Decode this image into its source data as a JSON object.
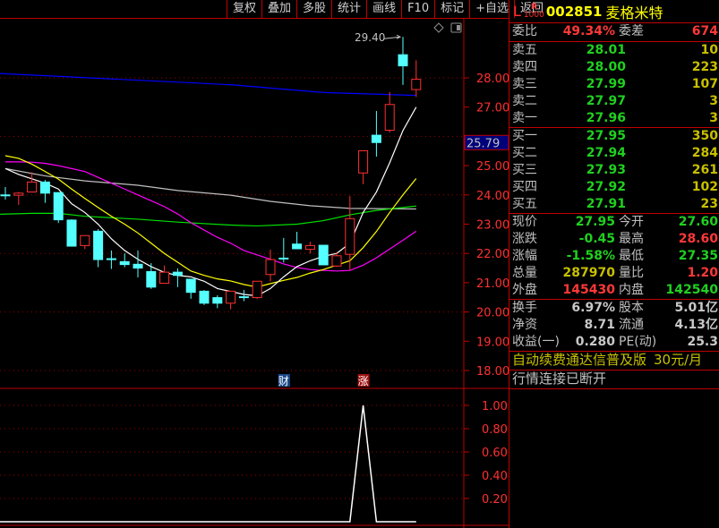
{
  "toolbar": {
    "buttons": [
      "复权",
      "叠加",
      "多股",
      "统计",
      "画线",
      "F10",
      "标记",
      "+自选",
      "返回"
    ]
  },
  "stock": {
    "prefix": "L",
    "badge_top": "R",
    "badge_bottom": "1000",
    "code": "002851",
    "name": "麦格米特"
  },
  "weibi": {
    "label": "委比",
    "value": "49.34%",
    "label2": "委差",
    "value2": "674"
  },
  "sell": [
    {
      "label": "卖五",
      "price": "28.01",
      "vol": "10"
    },
    {
      "label": "卖四",
      "price": "28.00",
      "vol": "223"
    },
    {
      "label": "卖三",
      "price": "27.99",
      "vol": "107"
    },
    {
      "label": "卖二",
      "price": "27.97",
      "vol": "3"
    },
    {
      "label": "卖一",
      "price": "27.96",
      "vol": "3"
    }
  ],
  "buy": [
    {
      "label": "买一",
      "price": "27.95",
      "vol": "350"
    },
    {
      "label": "买二",
      "price": "27.94",
      "vol": "284"
    },
    {
      "label": "买三",
      "price": "27.93",
      "vol": "261"
    },
    {
      "label": "买四",
      "price": "27.92",
      "vol": "102"
    },
    {
      "label": "买五",
      "price": "27.91",
      "vol": "23"
    }
  ],
  "quote": [
    {
      "l1": "现价",
      "v1": "27.95",
      "c1": "g",
      "l2": "今开",
      "v2": "27.60",
      "c2": "g"
    },
    {
      "l1": "涨跌",
      "v1": "-0.45",
      "c1": "g",
      "l2": "最高",
      "v2": "28.60",
      "c2": "r"
    },
    {
      "l1": "涨幅",
      "v1": "-1.58%",
      "c1": "g",
      "l2": "最低",
      "v2": "27.35",
      "c2": "g"
    },
    {
      "l1": "总量",
      "v1": "287970",
      "c1": "y",
      "l2": "量比",
      "v2": "1.20",
      "c2": "r"
    },
    {
      "l1": "外盘",
      "v1": "145430",
      "c1": "r",
      "l2": "内盘",
      "v2": "142540",
      "c2": "g"
    }
  ],
  "finance": [
    {
      "l1": "换手",
      "v1": "6.97%",
      "l2": "股本",
      "v2": "5.01亿"
    },
    {
      "l1": "净资",
      "v1": "8.71",
      "l2": "流通",
      "v2": "4.13亿"
    },
    {
      "l1": "收益(一)",
      "v1": "0.280",
      "l2": "PE(动)",
      "v2": "25.3"
    }
  ],
  "promo": {
    "text": "自动续费通达信普及版",
    "price": "30元/月"
  },
  "status": "行情连接已断开",
  "chart_data": [
    {
      "type": "candlestick",
      "price_axis": {
        "ticks": [
          "28.00",
          "27.00",
          "25.00",
          "24.00",
          "23.00",
          "22.00",
          "21.00",
          "20.00",
          "19.00",
          "18.00"
        ],
        "range": [
          17.9,
          29.8
        ],
        "grid": [
          28,
          26,
          24,
          22,
          20,
          18
        ]
      },
      "current_price_label": "25.79",
      "high_annotation": "29.40",
      "colors": {
        "up": "#ff3030",
        "down": "#54ffff",
        "ma5": "#ffffff",
        "ma10": "#ffff00",
        "ma20": "#ff00ff",
        "ma60": "#c0c0c0",
        "ma_green": "#00e000",
        "ma_blue": "#0000ff"
      },
      "candles": [
        [
          24.0,
          24.27,
          23.84,
          24.0
        ],
        [
          23.99,
          24.1,
          23.66,
          24.06
        ],
        [
          24.1,
          24.77,
          24.1,
          24.44
        ],
        [
          24.44,
          24.51,
          23.73,
          24.06
        ],
        [
          24.08,
          24.08,
          23.04,
          23.15
        ],
        [
          23.14,
          23.17,
          22.23,
          22.25
        ],
        [
          22.27,
          22.61,
          22.15,
          22.61
        ],
        [
          22.76,
          22.83,
          21.53,
          21.79
        ],
        [
          21.82,
          22.1,
          21.47,
          21.79
        ],
        [
          21.72,
          22.0,
          21.53,
          21.62
        ],
        [
          21.63,
          22.1,
          21.18,
          21.5
        ],
        [
          21.38,
          21.67,
          20.79,
          20.85
        ],
        [
          20.98,
          21.59,
          20.98,
          21.36
        ],
        [
          21.36,
          21.49,
          20.85,
          21.25
        ],
        [
          21.12,
          21.12,
          20.45,
          20.67
        ],
        [
          20.71,
          20.75,
          20.24,
          20.3
        ],
        [
          20.49,
          20.57,
          20.13,
          20.3
        ],
        [
          20.3,
          20.71,
          20.09,
          20.71
        ],
        [
          20.52,
          20.75,
          20.37,
          20.52
        ],
        [
          20.49,
          21.05,
          20.45,
          21.05
        ],
        [
          21.28,
          22.13,
          21.04,
          21.79
        ],
        [
          21.84,
          22.53,
          21.69,
          21.84
        ],
        [
          22.32,
          22.74,
          22.16,
          22.16
        ],
        [
          22.14,
          22.4,
          22.0,
          22.27
        ],
        [
          22.28,
          22.28,
          21.61,
          21.61
        ],
        [
          21.57,
          22.05,
          21.54,
          21.92
        ],
        [
          21.97,
          23.96,
          21.43,
          23.19
        ],
        [
          24.75,
          25.51,
          24.37,
          25.51
        ],
        [
          26.04,
          26.87,
          25.31,
          25.79
        ],
        [
          26.21,
          27.52,
          26.13,
          27.09
        ],
        [
          28.79,
          29.4,
          27.76,
          28.41
        ],
        [
          27.6,
          28.6,
          27.35,
          27.95
        ]
      ],
      "ma_lines": {
        "ma5": [
          24.9,
          24.7,
          24.55,
          24.4,
          24.2,
          23.7,
          23.4,
          23.0,
          22.5,
          22.1,
          21.8,
          21.55,
          21.35,
          21.25,
          21.2,
          21.05,
          20.8,
          20.7,
          20.6,
          20.55,
          20.8,
          21.2,
          21.55,
          21.75,
          21.9,
          22.0,
          22.35,
          23.4,
          24.1,
          25.1,
          26.2,
          27.0
        ],
        "ma10": [
          25.34,
          25.25,
          25.05,
          24.8,
          24.54,
          24.2,
          23.88,
          23.57,
          23.27,
          23.0,
          22.7,
          22.35,
          22.0,
          21.7,
          21.4,
          21.25,
          21.13,
          21.06,
          20.94,
          20.85,
          20.97,
          21.08,
          21.18,
          21.33,
          21.45,
          21.6,
          21.75,
          22.2,
          22.75,
          23.4,
          24.0,
          24.56
        ],
        "ma20": [
          25.13,
          25.13,
          25.12,
          25.08,
          25.0,
          24.9,
          24.8,
          24.6,
          24.4,
          24.2,
          24.0,
          23.8,
          23.6,
          23.35,
          23.05,
          22.8,
          22.55,
          22.35,
          22.1,
          21.95,
          21.8,
          21.64,
          21.52,
          21.45,
          21.42,
          21.4,
          21.42,
          21.6,
          21.85,
          22.15,
          22.45,
          22.76
        ],
        "ma60": [
          [
            0,
            24.9
          ],
          [
            3,
            24.65
          ],
          [
            6,
            24.48
          ],
          [
            10,
            24.33
          ],
          [
            13,
            24.15
          ],
          [
            17,
            23.99
          ],
          [
            20,
            23.78
          ],
          [
            23,
            23.63
          ],
          [
            26,
            23.54
          ],
          [
            31,
            23.52
          ]
        ],
        "ma_green": [
          [
            -0.4,
            23.34
          ],
          [
            2,
            23.37
          ],
          [
            4,
            23.37
          ],
          [
            6,
            23.27
          ],
          [
            10,
            23.17
          ],
          [
            13,
            23.07
          ],
          [
            17,
            22.97
          ],
          [
            19,
            22.94
          ],
          [
            22,
            23.0
          ],
          [
            24,
            23.12
          ],
          [
            26,
            23.32
          ],
          [
            28,
            23.47
          ],
          [
            31,
            23.62
          ]
        ],
        "ma_blue": [
          [
            -0.4,
            28.15
          ],
          [
            17.2,
            27.76
          ],
          [
            24,
            27.5
          ],
          [
            31,
            27.4
          ]
        ]
      },
      "markers": [
        {
          "index": 21,
          "text": "财",
          "color": "#1a4a8a"
        },
        {
          "index": 27,
          "text": "涨",
          "color": "#a01010"
        }
      ]
    },
    {
      "type": "line",
      "y_ticks": [
        "1.00",
        "0.80",
        "0.60",
        "0.40",
        "0.20"
      ],
      "ylim": [
        0,
        1.1
      ],
      "values": [
        0,
        0,
        0,
        0,
        0,
        0,
        0,
        0,
        0,
        0,
        0,
        0,
        0,
        0,
        0,
        0,
        0,
        0,
        0,
        0,
        0,
        0,
        0,
        0,
        0,
        0,
        0,
        1,
        0,
        0,
        0,
        0
      ]
    }
  ]
}
